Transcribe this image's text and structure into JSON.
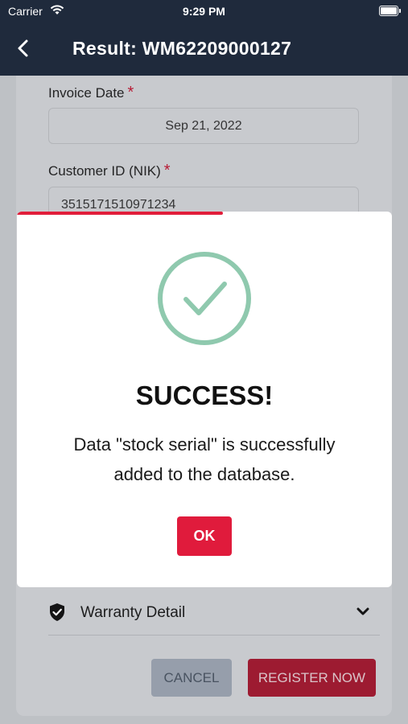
{
  "status_bar": {
    "carrier": "Carrier",
    "time": "9:29 PM"
  },
  "nav": {
    "title": "Result: WM62209000127"
  },
  "form": {
    "invoice_date": {
      "label": "Invoice Date",
      "required": "*",
      "value": "Sep 21, 2022"
    },
    "customer_id": {
      "label": "Customer ID (NIK)",
      "required": "*",
      "value": "3515171510971234"
    },
    "warranty": {
      "label": "Warranty Detail"
    },
    "cancel_label": "CANCEL",
    "register_label": "REGISTER NOW"
  },
  "dialog": {
    "title": "SUCCESS!",
    "message": "Data \"stock serial\" is successfully added to the database.",
    "ok_label": "OK",
    "timer_progress": 0.55
  },
  "colors": {
    "header_bg": "#1f2a3c",
    "accent_red": "#e01b3c",
    "success_green": "#8fc9ae"
  },
  "icons": [
    "wifi-icon",
    "battery-icon",
    "back-arrow-icon",
    "shield-icon",
    "chevron-down-icon",
    "check-circle-icon"
  ]
}
